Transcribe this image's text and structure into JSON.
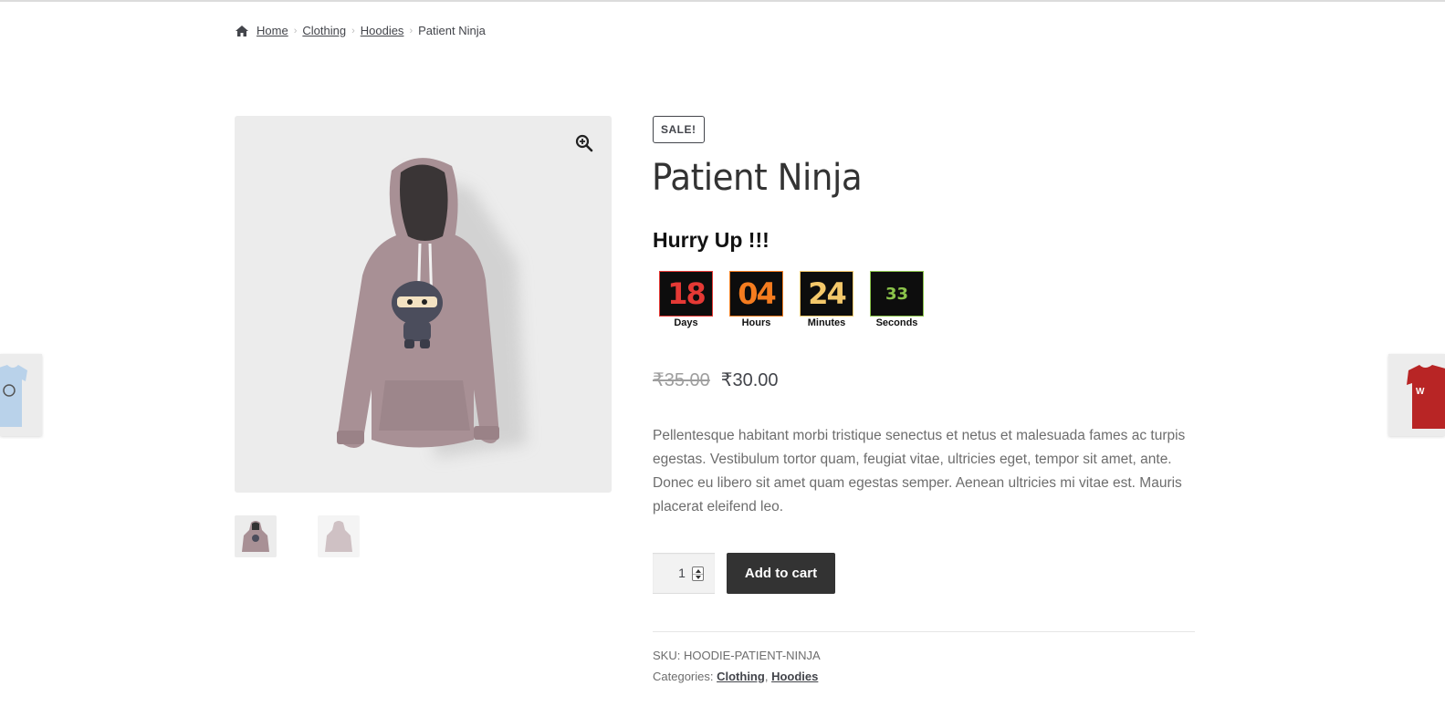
{
  "breadcrumb": {
    "home": "Home",
    "items": [
      "Clothing",
      "Hoodies"
    ],
    "current": "Patient Ninja"
  },
  "product": {
    "sale_badge": "SALE!",
    "title": "Patient Ninja",
    "hurry": "Hurry Up !!!",
    "countdown": {
      "days": {
        "value": "18",
        "label": "Days",
        "color": "#e53935"
      },
      "hours": {
        "value": "04",
        "label": "Hours",
        "color": "#f57c1f"
      },
      "minutes": {
        "value": "24",
        "label": "Minutes",
        "color": "#f4c86a"
      },
      "seconds": {
        "value": "33",
        "label": "Seconds",
        "color": "#8bc34a"
      }
    },
    "price_old": "₹35.00",
    "price_new": "₹30.00",
    "description": "Pellentesque habitant morbi tristique senectus et netus et malesuada fames ac turpis egestas. Vestibulum tortor quam, feugiat vitae, ultricies eget, tempor sit amet, ante. Donec eu libero sit amet quam egestas semper. Aenean ultricies mi vitae est. Mauris placerat eleifend leo.",
    "quantity": "1",
    "add_to_cart": "Add to cart",
    "sku_label": "SKU:",
    "sku": "HOODIE-PATIENT-NINJA",
    "categories_label": "Categories:",
    "categories": [
      "Clothing",
      "Hoodies"
    ],
    "category_separator": ","
  },
  "icons": {
    "home": "home-icon",
    "zoom": "zoom-in-icon"
  },
  "colors": {
    "hoodie": "#a89095",
    "button": "#333333",
    "image_bg": "#ececec"
  }
}
